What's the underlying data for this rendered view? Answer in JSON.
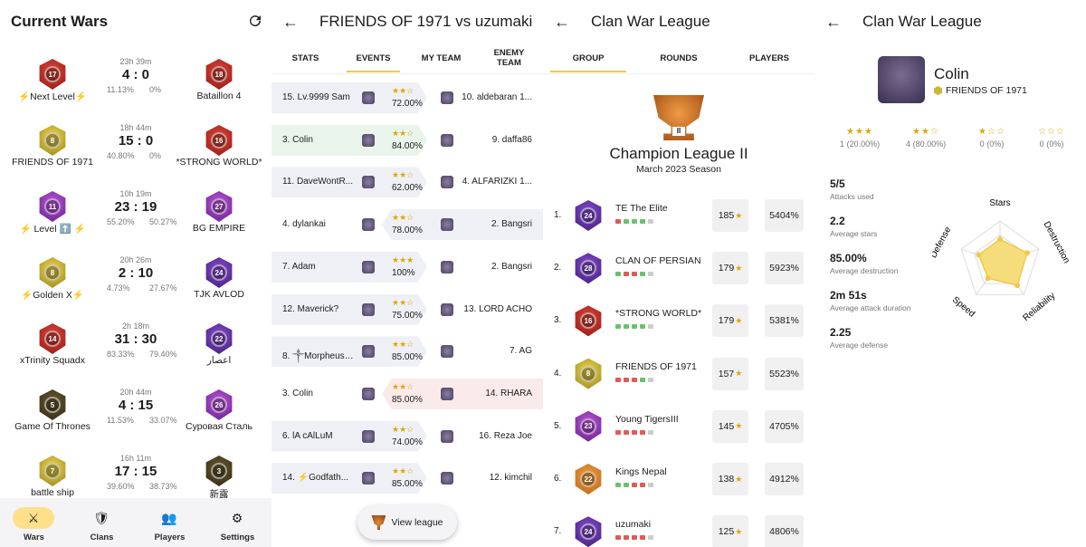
{
  "current_wars": {
    "title": "Current Wars",
    "wars": [
      {
        "left_name": "⚡Next Level⚡",
        "right_name": "Bataillon 4",
        "time": "23h 39m",
        "score": "4 : 0",
        "left_pct": "11.13%",
        "right_pct": "0%",
        "left_badge": "b-red",
        "right_badge": "b-red",
        "left_lvl": "17",
        "right_lvl": "18"
      },
      {
        "left_name": "FRIENDS OF 1971",
        "right_name": "*STRONG WORLD*",
        "time": "18h 44m",
        "score": "15 : 0",
        "left_pct": "40.80%",
        "right_pct": "0%",
        "left_badge": "b-gold",
        "right_badge": "b-red",
        "left_lvl": "8",
        "right_lvl": "16"
      },
      {
        "left_name": "⚡ Level ⬆️ ⚡",
        "right_name": "BG EMPIRE",
        "time": "10h 19m",
        "score": "23 : 19",
        "left_pct": "55.20%",
        "right_pct": "50.27%",
        "left_badge": "b-purple",
        "right_badge": "b-purple",
        "left_lvl": "11",
        "right_lvl": "27"
      },
      {
        "left_name": "⚡Golden X⚡",
        "right_name": "TJK AVLOD",
        "time": "20h 26m",
        "score": "2 : 10",
        "left_pct": "4.73%",
        "right_pct": "27.67%",
        "left_badge": "b-gold",
        "right_badge": "b-violet",
        "left_lvl": "8",
        "right_lvl": "24"
      },
      {
        "left_name": "xTrinity Squadx",
        "right_name": "اعصار",
        "time": "2h 18m",
        "score": "31 : 30",
        "left_pct": "83.33%",
        "right_pct": "79.40%",
        "left_badge": "b-red",
        "right_badge": "b-violet",
        "left_lvl": "14",
        "right_lvl": "22"
      },
      {
        "left_name": "Game Of Thrones",
        "right_name": "Суровая Сталь",
        "time": "20h 44m",
        "score": "4 : 15",
        "left_pct": "11.53%",
        "right_pct": "33.07%",
        "left_badge": "b-dark",
        "right_badge": "b-purple",
        "left_lvl": "5",
        "right_lvl": "26"
      },
      {
        "left_name": "battle ship",
        "right_name": "新露",
        "time": "16h 11m",
        "score": "17 : 15",
        "left_pct": "39.60%",
        "right_pct": "38.73%",
        "left_badge": "b-gold",
        "right_badge": "b-dark",
        "left_lvl": "7",
        "right_lvl": "3"
      }
    ],
    "nav": [
      {
        "label": "Wars",
        "icon": "⚔"
      },
      {
        "label": "Clans",
        "icon": "🛡"
      },
      {
        "label": "Players",
        "icon": "👥"
      },
      {
        "label": "Settings",
        "icon": "⚙"
      }
    ]
  },
  "war_detail": {
    "title": "FRIENDS OF 1971 vs uzumaki",
    "tabs": [
      "STATS",
      "EVENTS",
      "MY TEAM",
      "ENEMY TEAM"
    ],
    "events": [
      {
        "attacker": "15. Lv.9999 Sam",
        "defender": "10. aldebaran 1...",
        "stars": "★★☆",
        "pct": "72.00%",
        "side": "left",
        "hl": ""
      },
      {
        "attacker": "3. Colin",
        "defender": "9. daffa86",
        "stars": "★★☆",
        "pct": "84.00%",
        "side": "left",
        "hl": "#e9f5ea"
      },
      {
        "attacker": "11. DaveWontR...",
        "defender": "4. ALFARIZKI 1...",
        "stars": "★★☆",
        "pct": "62.00%",
        "side": "left",
        "hl": ""
      },
      {
        "attacker": "4. dylankai",
        "defender": "2. Bangsri",
        "stars": "★★☆",
        "pct": "78.00%",
        "side": "right",
        "hl": ""
      },
      {
        "attacker": "7. Adam",
        "defender": "2. Bangsri",
        "stars": "★★★",
        "pct": "100%",
        "side": "left",
        "hl": ""
      },
      {
        "attacker": "12. Maverick?",
        "defender": "13. LORD ACHO",
        "stars": "★★☆",
        "pct": "75.00%",
        "side": "left",
        "hl": ""
      },
      {
        "attacker": "8. ༒Morpheus༒",
        "defender": "7. AG",
        "stars": "★★☆",
        "pct": "85.00%",
        "side": "left",
        "hl": ""
      },
      {
        "attacker": "3. Colin",
        "defender": "14. RHARA",
        "stars": "★★☆",
        "pct": "85.00%",
        "side": "right",
        "hl": "#fbeaea"
      },
      {
        "attacker": "6. lA cAlLuM",
        "defender": "16. Reza Joe",
        "stars": "★★☆",
        "pct": "74.00%",
        "side": "left",
        "hl": ""
      },
      {
        "attacker": "14. ⚡Godfath...",
        "defender": "12. kimchil",
        "stars": "★★☆",
        "pct": "85.00%",
        "side": "left",
        "hl": ""
      }
    ],
    "view_league": "View league"
  },
  "cwl": {
    "title": "Clan War League",
    "tabs": [
      "GROUP",
      "ROUNDS",
      "PLAYERS"
    ],
    "league_name": "Champion League II",
    "season": "March 2023 Season",
    "trophy_label": "II",
    "clans": [
      {
        "rank": "1.",
        "name": "TE The Elite",
        "stars": "185",
        "dest": "5404%",
        "badge": "b-violet",
        "lvl": "24",
        "dots": [
          "#e05a5a",
          "#6cc070",
          "#6cc070",
          "#6cc070",
          "#ccc"
        ]
      },
      {
        "rank": "2.",
        "name": "CLAN OF PERSIAN",
        "stars": "179",
        "dest": "5923%",
        "badge": "b-violet",
        "lvl": "28",
        "dots": [
          "#6cc070",
          "#e05a5a",
          "#e05a5a",
          "#6cc070",
          "#ccc"
        ]
      },
      {
        "rank": "3.",
        "name": "*STRONG WORLD*",
        "stars": "179",
        "dest": "5381%",
        "badge": "b-red",
        "lvl": "16",
        "dots": [
          "#6cc070",
          "#6cc070",
          "#6cc070",
          "#6cc070",
          "#ccc"
        ]
      },
      {
        "rank": "4.",
        "name": "FRIENDS OF 1971",
        "stars": "157",
        "dest": "5523%",
        "badge": "b-gold",
        "lvl": "8",
        "dots": [
          "#e05a5a",
          "#e05a5a",
          "#e05a5a",
          "#6cc070",
          "#ccc"
        ]
      },
      {
        "rank": "5.",
        "name": "Young TigersIII",
        "stars": "145",
        "dest": "4705%",
        "badge": "b-purple",
        "lvl": "23",
        "dots": [
          "#e05a5a",
          "#e05a5a",
          "#e05a5a",
          "#e05a5a",
          "#ccc"
        ]
      },
      {
        "rank": "6.",
        "name": "Kings Nepal",
        "stars": "138",
        "dest": "4912%",
        "badge": "b-orange",
        "lvl": "22",
        "dots": [
          "#6cc070",
          "#6cc070",
          "#e05a5a",
          "#e05a5a",
          "#ccc"
        ]
      },
      {
        "rank": "7.",
        "name": "uzumaki",
        "stars": "125",
        "dest": "4806%",
        "badge": "b-violet",
        "lvl": "24",
        "dots": [
          "#e05a5a",
          "#e05a5a",
          "#e05a5a",
          "#e05a5a",
          "#ccc"
        ]
      }
    ]
  },
  "player": {
    "title": "Clan War League",
    "name": "Colin",
    "clan": "FRIENDS OF 1971",
    "star_dist": [
      {
        "stars": "★★★",
        "count": "1",
        "pct": "(20.00%)"
      },
      {
        "stars": "★★☆",
        "count": "4",
        "pct": "(80.00%)"
      },
      {
        "stars": "★☆☆",
        "count": "0",
        "pct": "(0%)"
      },
      {
        "stars": "☆☆☆",
        "count": "0",
        "pct": "(0%)"
      }
    ],
    "stats": [
      {
        "value": "5/5",
        "label": "Attacks used"
      },
      {
        "value": "2.2",
        "label": "Average stars"
      },
      {
        "value": "85.00%",
        "label": "Average destruction"
      },
      {
        "value": "2m 51s",
        "label": "Average attack duration"
      },
      {
        "value": "2.25",
        "label": "Average defense"
      }
    ],
    "radar": {
      "axes": [
        "Stars",
        "Destruction",
        "Reliability",
        "Speed",
        "Defense"
      ],
      "values": [
        0.55,
        0.7,
        0.72,
        0.5,
        0.55
      ]
    },
    "colors": {
      "accent": "#f2c94c",
      "fill": "#f6dd7c"
    }
  }
}
